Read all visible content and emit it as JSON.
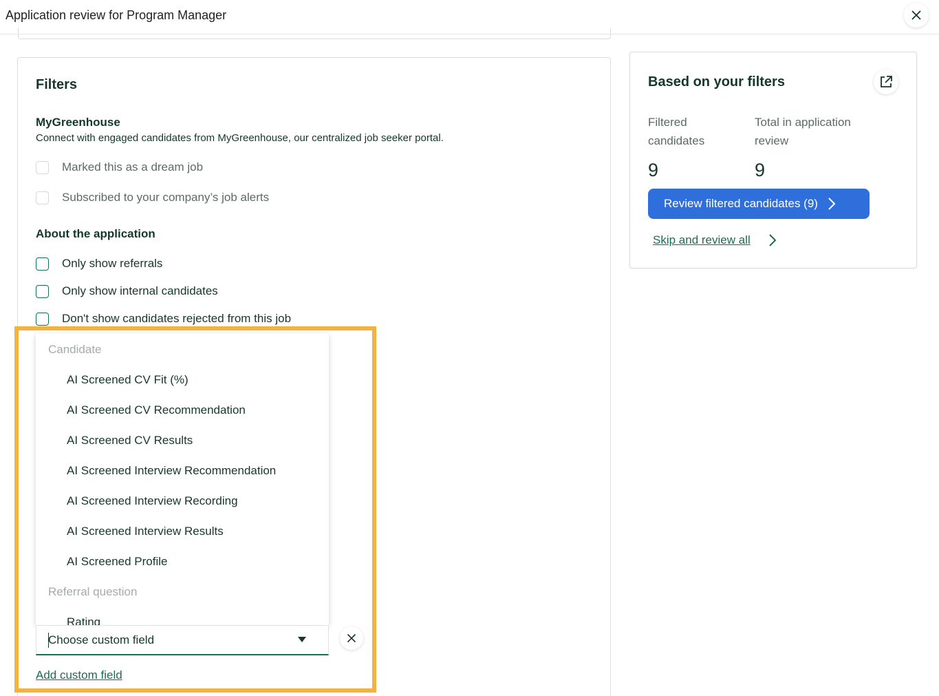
{
  "header": {
    "title": "Application review for Program Manager"
  },
  "filters": {
    "title": "Filters",
    "mygreenhouse": {
      "title": "MyGreenhouse",
      "description": "Connect with engaged candidates from MyGreenhouse, our centralized job seeker portal.",
      "options": [
        {
          "label": "Marked this as a dream job",
          "checked": false,
          "disabled": true
        },
        {
          "label": "Subscribed to your company’s job alerts",
          "checked": false,
          "disabled": true
        }
      ]
    },
    "about": {
      "title": "About the application",
      "options": [
        {
          "label": "Only show referrals",
          "checked": false
        },
        {
          "label": "Only show internal candidates",
          "checked": false
        },
        {
          "label": "Don't show candidates rejected from this job",
          "checked": false
        }
      ]
    },
    "custom_field": {
      "dropdown": {
        "groups": [
          {
            "label": "Candidate",
            "items": [
              "AI Screened CV Fit (%)",
              "AI Screened CV Recommendation",
              "AI Screened CV Results",
              "AI Screened Interview Recommendation",
              "AI Screened Interview Recording",
              "AI Screened Interview Results",
              "AI Screened Profile"
            ]
          },
          {
            "label": "Referral question",
            "items": [
              "Rating"
            ]
          }
        ]
      },
      "placeholder": "Choose custom field",
      "add_link": "Add custom field"
    }
  },
  "summary": {
    "title": "Based on your filters",
    "filtered_label": "Filtered candidates",
    "filtered_value": "9",
    "total_label": "Total in application review",
    "total_value": "9",
    "primary_button": "Review filtered candidates (9)",
    "skip_link": "Skip and review all"
  },
  "colors": {
    "primary": "#2f6fdc",
    "accent_green": "#1b6c56",
    "highlight": "#f6b23c",
    "text": "#15372c"
  },
  "icons": {
    "close": "close-icon",
    "external": "external-link-icon",
    "chevron": "chevron-right-icon",
    "dropdown_arrow": "caret-down-icon"
  }
}
